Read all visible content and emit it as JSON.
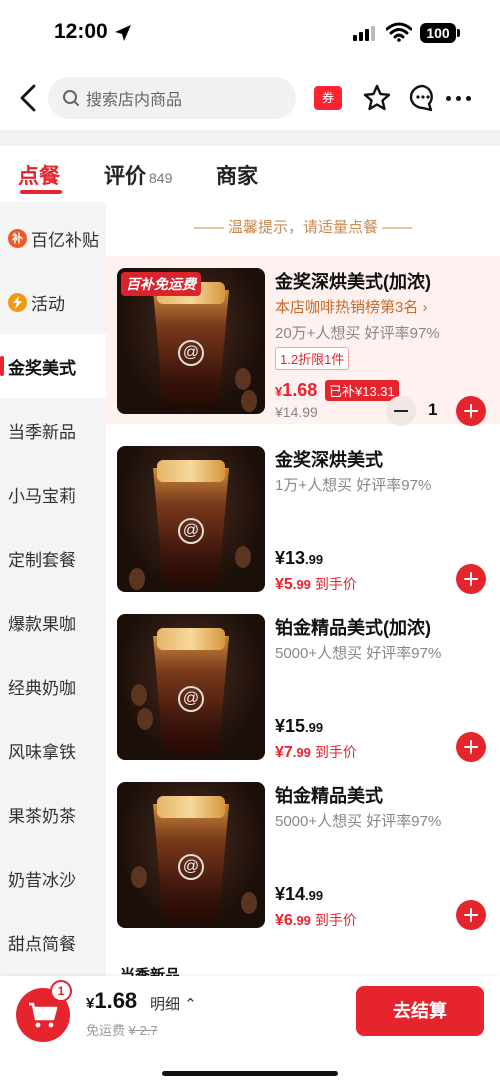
{
  "status": {
    "time": "12:00",
    "battery": "100"
  },
  "nav": {
    "search_placeholder": "搜索店内商品",
    "coupon_label": "券"
  },
  "tabs": [
    {
      "label": "点餐"
    },
    {
      "label": "评价",
      "count": "849"
    },
    {
      "label": "商家"
    }
  ],
  "sidebar": {
    "items": [
      {
        "label": "百亿补贴",
        "badge": "补"
      },
      {
        "label": "活动"
      },
      {
        "label": "金奖美式"
      },
      {
        "label": "当季新品"
      },
      {
        "label": "小马宝莉"
      },
      {
        "label": "定制套餐"
      },
      {
        "label": "爆款果咖"
      },
      {
        "label": "经典奶咖"
      },
      {
        "label": "风味拿铁"
      },
      {
        "label": "果茶奶茶"
      },
      {
        "label": "奶昔冰沙"
      },
      {
        "label": "甜点简餐"
      }
    ]
  },
  "content": {
    "hint": "—— 温馨提示，请适量点餐 ——",
    "next_section": "当季新品",
    "products": [
      {
        "promo_tag": "百补免运费",
        "name": "金奖深烘美式(加浓)",
        "rank": "本店咖啡热销榜第3名 ›",
        "stats": "20万+人想买  好评率97%",
        "limit": "1.2折限1件",
        "price_symbol": "¥",
        "price": "1.68",
        "subsidy": "已补¥13.31",
        "orig_price": "¥14.99",
        "qty": "1"
      },
      {
        "name": "金奖深烘美式",
        "stats": "1万+人想买  好评率97%",
        "price_int": "¥13",
        "price_dec": ".99",
        "hand_price_int": "¥5",
        "hand_price_dec": ".99",
        "hand_suffix": "到手价"
      },
      {
        "name": "铂金精品美式(加浓)",
        "stats": "5000+人想买  好评率97%",
        "price_int": "¥15",
        "price_dec": ".99",
        "hand_price_int": "¥7",
        "hand_price_dec": ".99",
        "hand_suffix": "到手价"
      },
      {
        "name": "铂金精品美式",
        "stats": "5000+人想买  好评率97%",
        "price_int": "¥14",
        "price_dec": ".99",
        "hand_price_int": "¥6",
        "hand_price_dec": ".99",
        "hand_suffix": "到手价"
      }
    ]
  },
  "cart": {
    "count": "1",
    "total_symbol": "¥",
    "total": "1.68",
    "detail": "明细 ⌃",
    "fee_label": "免运费",
    "fee_orig": "¥ 2.7",
    "checkout": "去结算"
  },
  "colors": {
    "accent": "#e6242e",
    "hint": "#c98a4f",
    "rank": "#c96a2a"
  }
}
